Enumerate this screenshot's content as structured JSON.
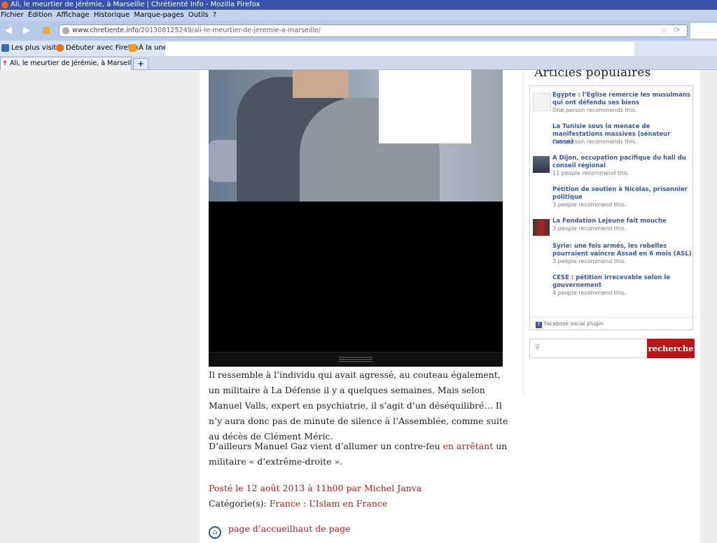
{
  "window": {
    "title": "Ali, le meurtier de Jérémie, à Marseille | Chrétienté Info - Mozilla Firefox"
  },
  "menu": [
    "Fichier",
    "Édition",
    "Affichage",
    "Historique",
    "Marque-pages",
    "Outils",
    "?"
  ],
  "nav": {
    "url_host": "www.chretiente.info",
    "url_path": "/201308125249/ali-le-meurtier-de-jeremie-a-marseille/"
  },
  "bookmarks": [
    {
      "label": "Les plus visités",
      "icon": "folder-icon"
    },
    {
      "label": "Débuter avec Firefox",
      "icon": "firefox-icon"
    },
    {
      "label": "À la une",
      "icon": "rss-icon"
    }
  ],
  "tabs": [
    {
      "label": "Ali, le meurtier de Jérémie, à Marseille | ..."
    }
  ],
  "article": {
    "para1": "Il ressemble à l’individu qui avait agressé, au couteau également, un militaire à La Défense il y a quelques semaines. Mais selon Manuel Valls, expert en psychiatrie, il s’agit d’un déséquilibré… Il n’y aura donc pas de minute de silence à l’Assemblée, comme suite au décès de Clément Méric.",
    "para2_before": "D’ailleurs Manuel Gaz vient d’allumer un contre-feu",
    "para2_link": "en arrêtant",
    "para2_after": "un militaire « d’extrême-droite ».",
    "posted": "Posté le 12 août 2013 à 11h00 par Michel Janva",
    "category_label": "Catégorie(s):",
    "category_value": "France : L’Islam en France",
    "footer_links": "page d’accueilhaut de page"
  },
  "sidebar": {
    "title": "Articles populaires",
    "items": [
      {
        "title": "Egypte : l’Eglise remercie les musulmans qui ont défendu ses biens",
        "rec": "One person recommends this."
      },
      {
        "title": "La Tunisie sous la menace de manifestations massives (sénateur russe)",
        "rec": "One person recommends this."
      },
      {
        "title": "A Dijon, occupation pacifique du hall du conseil régional",
        "rec": "11 people recommend this."
      },
      {
        "title": "Pétition de soutien à Nicolas, prisonnier politique",
        "rec": "3 people recommend this."
      },
      {
        "title": "La Fondation Lejeune fait mouche",
        "rec": "3 people recommend this."
      },
      {
        "title": "Syrie: une fois armés, les rebelles pourraient vaincre Assad en 6 mois (ASL)",
        "rec": "3 people recommend this."
      },
      {
        "title": "CESE : pétition irrecevable selon le gouvernement",
        "rec": "4 people recommend this."
      }
    ],
    "plugin": "Facebook social plugin",
    "search_button": "recherche"
  }
}
